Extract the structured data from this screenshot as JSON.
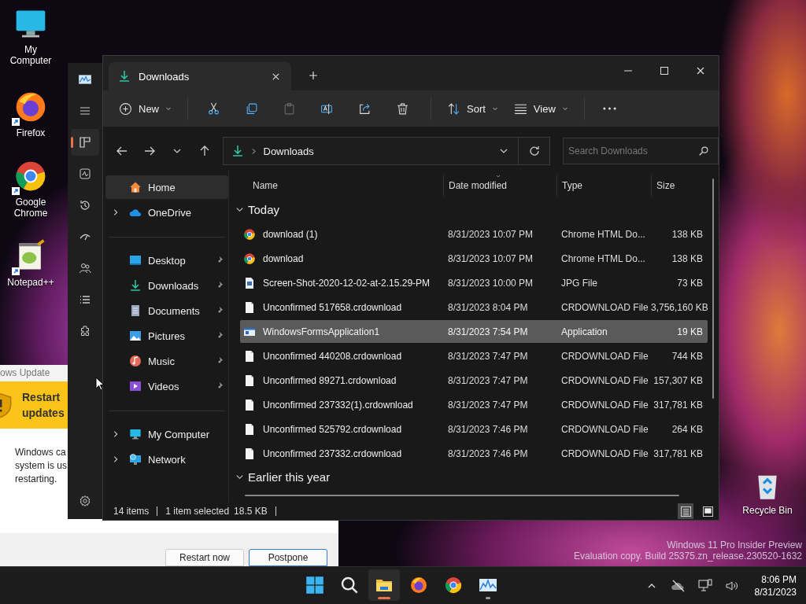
{
  "desktop_icons": [
    {
      "label": "My Computer",
      "kind": "computer"
    },
    {
      "label": "Firefox",
      "kind": "firefox"
    },
    {
      "label": "Google Chrome",
      "kind": "chrome"
    },
    {
      "label": "Notepad++",
      "kind": "notepad"
    }
  ],
  "recycle_bin": {
    "label": "Recycle Bin"
  },
  "windows_update": {
    "title": "ows Update",
    "heading": "Restart updates",
    "body": [
      "Windows ca",
      "system is us",
      "restarting."
    ],
    "buttons": [
      {
        "label": "Restart now",
        "default": false
      },
      {
        "label": "Postpone",
        "default": true
      }
    ]
  },
  "task_manager": {
    "nav": [
      {
        "kind": "processes",
        "selected": true
      },
      {
        "kind": "performance",
        "selected": false
      },
      {
        "kind": "history",
        "selected": false
      },
      {
        "kind": "startup",
        "selected": false
      },
      {
        "kind": "users",
        "selected": false
      },
      {
        "kind": "details",
        "selected": false
      },
      {
        "kind": "services",
        "selected": false
      }
    ]
  },
  "explorer": {
    "tab": {
      "title": "Downloads"
    },
    "toolbar": {
      "new": "New",
      "sort": "Sort",
      "view": "View",
      "actions": [
        {
          "kind": "cut",
          "disabled": false
        },
        {
          "kind": "copy",
          "disabled": false
        },
        {
          "kind": "paste",
          "disabled": true
        },
        {
          "kind": "rename",
          "disabled": false
        },
        {
          "kind": "share",
          "disabled": false
        },
        {
          "kind": "delete",
          "disabled": false
        }
      ]
    },
    "address": {
      "path": "Downloads"
    },
    "search": {
      "placeholder": "Search Downloads"
    },
    "nav_groups": [
      [
        {
          "label": "Home",
          "kind": "home",
          "selected": true,
          "pinned": false,
          "expandable": false
        },
        {
          "label": "OneDrive",
          "kind": "onedrive",
          "selected": false,
          "pinned": false,
          "expandable": true
        }
      ],
      [
        {
          "label": "Desktop",
          "kind": "desktop",
          "selected": false,
          "pinned": true,
          "expandable": false
        },
        {
          "label": "Downloads",
          "kind": "downloads",
          "selected": false,
          "pinned": true,
          "expandable": false
        },
        {
          "label": "Documents",
          "kind": "documents",
          "selected": false,
          "pinned": true,
          "expandable": false
        },
        {
          "label": "Pictures",
          "kind": "pictures",
          "selected": false,
          "pinned": true,
          "expandable": false
        },
        {
          "label": "Music",
          "kind": "music",
          "selected": false,
          "pinned": true,
          "expandable": false
        },
        {
          "label": "Videos",
          "kind": "videos",
          "selected": false,
          "pinned": true,
          "expandable": false
        }
      ],
      [
        {
          "label": "My Computer",
          "kind": "computer",
          "selected": false,
          "pinned": false,
          "expandable": true
        },
        {
          "label": "Network",
          "kind": "network",
          "selected": false,
          "pinned": false,
          "expandable": true
        }
      ]
    ],
    "columns": [
      {
        "label": "Name",
        "sorted": false
      },
      {
        "label": "Date modified",
        "sorted": true
      },
      {
        "label": "Type",
        "sorted": false
      },
      {
        "label": "Size",
        "sorted": false
      }
    ],
    "groups": [
      {
        "title": "Today",
        "expanded": true,
        "rows": [
          {
            "name": "download (1)",
            "date": "8/31/2023 10:07 PM",
            "type": "Chrome HTML Do...",
            "size": "138 KB",
            "kind": "chrome",
            "selected": false
          },
          {
            "name": "download",
            "date": "8/31/2023 10:07 PM",
            "type": "Chrome HTML Do...",
            "size": "138 KB",
            "kind": "chrome",
            "selected": false
          },
          {
            "name": "Screen-Shot-2020-12-02-at-2.15.29-PM",
            "date": "8/31/2023 10:00 PM",
            "type": "JPG File",
            "size": "73 KB",
            "kind": "image",
            "selected": false
          },
          {
            "name": "Unconfirmed 517658.crdownload",
            "date": "8/31/2023 8:04 PM",
            "type": "CRDOWNLOAD File",
            "size": "3,756,160 KB",
            "kind": "file",
            "selected": false
          },
          {
            "name": "WindowsFormsApplication1",
            "date": "8/31/2023 7:54 PM",
            "type": "Application",
            "size": "19 KB",
            "kind": "app",
            "selected": true
          },
          {
            "name": "Unconfirmed 440208.crdownload",
            "date": "8/31/2023 7:47 PM",
            "type": "CRDOWNLOAD File",
            "size": "744 KB",
            "kind": "file",
            "selected": false
          },
          {
            "name": "Unconfirmed 89271.crdownload",
            "date": "8/31/2023 7:47 PM",
            "type": "CRDOWNLOAD File",
            "size": "157,307 KB",
            "kind": "file",
            "selected": false
          },
          {
            "name": "Unconfirmed 237332(1).crdownload",
            "date": "8/31/2023 7:47 PM",
            "type": "CRDOWNLOAD File",
            "size": "317,781 KB",
            "kind": "file",
            "selected": false
          },
          {
            "name": "Unconfirmed 525792.crdownload",
            "date": "8/31/2023 7:46 PM",
            "type": "CRDOWNLOAD File",
            "size": "264 KB",
            "kind": "file",
            "selected": false
          },
          {
            "name": "Unconfirmed 237332.crdownload",
            "date": "8/31/2023 7:46 PM",
            "type": "CRDOWNLOAD File",
            "size": "317,781 KB",
            "kind": "file",
            "selected": false
          }
        ]
      },
      {
        "title": "Earlier this year",
        "expanded": true
      }
    ],
    "status": {
      "count": "14 items",
      "selection": "1 item selected",
      "size": "18.5 KB"
    },
    "views": [
      {
        "kind": "details",
        "selected": true
      },
      {
        "kind": "tiles",
        "selected": false
      }
    ]
  },
  "watermark": {
    "lines": [
      "Windows 11 Pro Insider Preview",
      "Evaluation copy. Build 25375.zn_release.230520-1632"
    ]
  },
  "taskbar": {
    "apps": [
      {
        "kind": "start",
        "active": false,
        "running": false
      },
      {
        "kind": "search",
        "active": false,
        "running": false
      },
      {
        "kind": "explorer",
        "active": true,
        "running": true
      },
      {
        "kind": "firefox",
        "active": false,
        "running": false
      },
      {
        "kind": "chrome",
        "active": false,
        "running": false
      },
      {
        "kind": "taskmgr",
        "active": false,
        "running": true
      }
    ],
    "tray": {
      "time": "8:06 PM",
      "date": "8/31/2023"
    }
  }
}
